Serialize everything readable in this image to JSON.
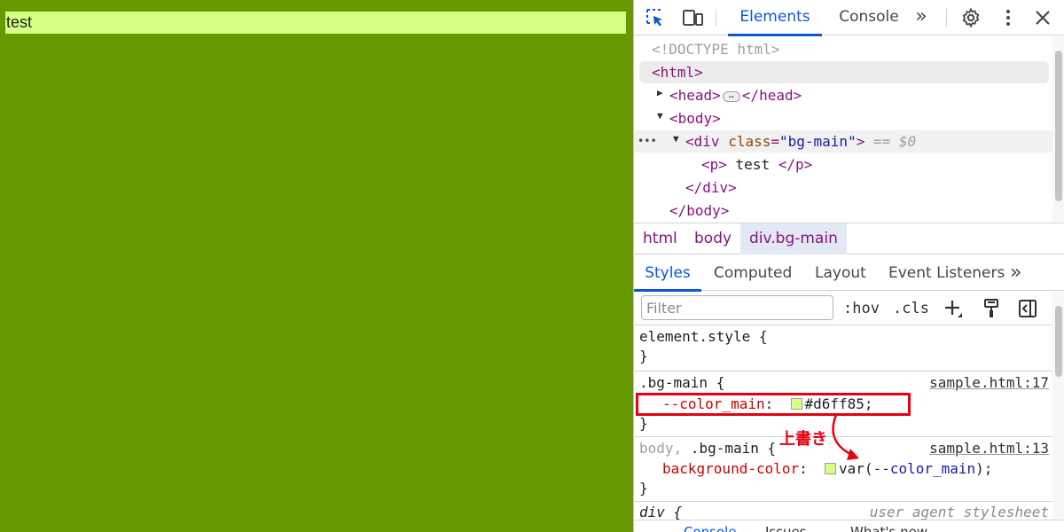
{
  "preview": {
    "paragraph_text": "test",
    "background_color": "#669900",
    "paragraph_color": "#d6ff85"
  },
  "devtools": {
    "toolbar": {
      "inspect_icon": "select-element-icon",
      "device_icon": "device-toolbar-icon",
      "tabs": [
        "Elements",
        "Console"
      ],
      "more_tabs": "»",
      "settings_icon": "gear-icon",
      "menu_icon": "kebab-icon",
      "close_icon": "close-icon"
    },
    "dom": {
      "doctype": "<!DOCTYPE html>",
      "html_open": "<html>",
      "head_open": "<head>",
      "head_close": "</head>",
      "body_open": "<body>",
      "div_tag": "div",
      "div_attr_name": "class",
      "div_attr_value": "\"bg-main\"",
      "selected_marker": "== $0",
      "p_open": "<p>",
      "p_text": "test",
      "p_close": "</p>",
      "div_close": "</div>",
      "body_close": "</body>",
      "row_dots": "•••"
    },
    "breadcrumb": [
      "html",
      "body",
      "div.bg-main"
    ],
    "styles_tabs": [
      "Styles",
      "Computed",
      "Layout",
      "Event Listeners"
    ],
    "styles_more": "»",
    "filter": {
      "placeholder": "Filter",
      "hov": ":hov",
      "cls": ".cls"
    },
    "rules": {
      "element_style": {
        "selector": "element.style {",
        "close": "}"
      },
      "bg_main": {
        "selector": ".bg-main {",
        "source": "sample.html:17",
        "property": "--color_main",
        "value": "#d6ff85;",
        "close": "}"
      },
      "body_bg_main": {
        "selector_gray": "body,",
        "selector": ".bg-main {",
        "source": "sample.html:13",
        "property": "background-color",
        "value_prefix": "var(",
        "value_var": "--color_main",
        "value_suffix": ");",
        "close": "}"
      },
      "div_rule": {
        "selector": "div {",
        "source": "user agent stylesheet"
      }
    },
    "annotation": {
      "label": "上書き",
      "color": "#e60012"
    },
    "drawer_tabs": [
      "Console",
      "Issues",
      "What's new"
    ]
  }
}
